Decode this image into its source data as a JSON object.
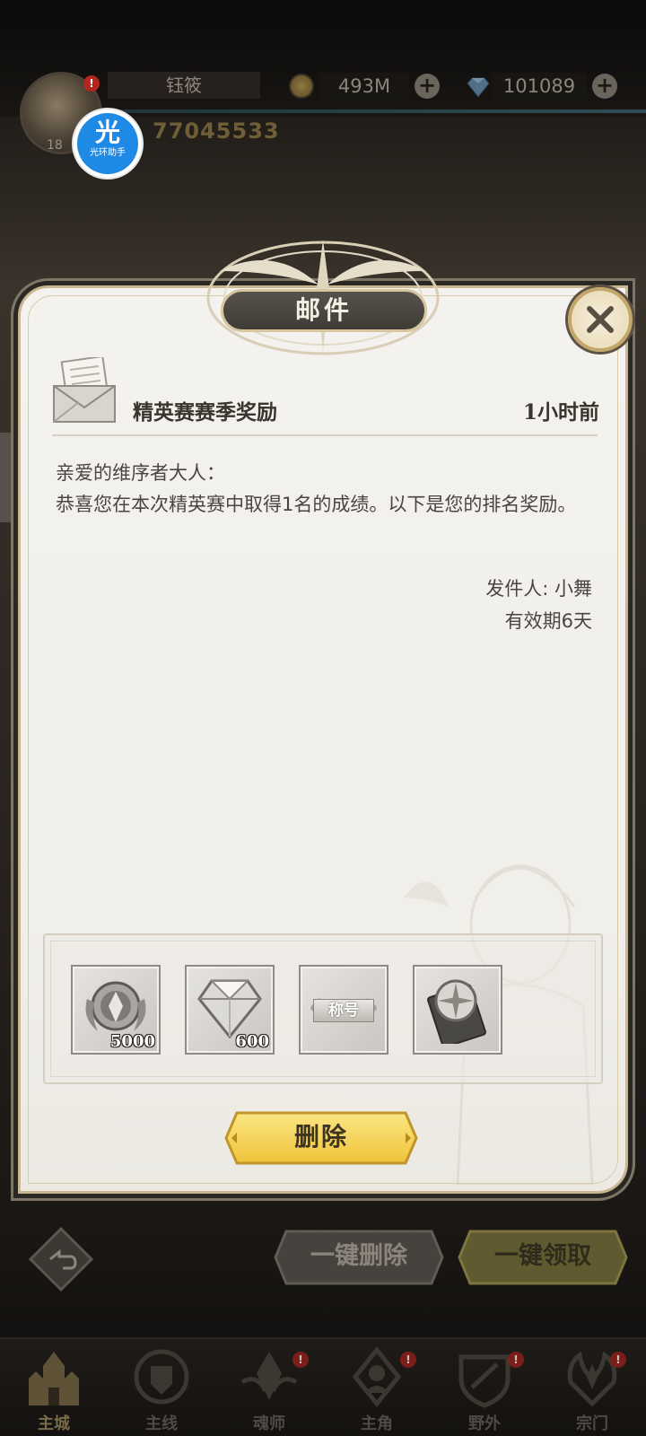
{
  "hud": {
    "player_name": "钰筱",
    "level": "18",
    "avatar_badge": "!",
    "gold": "493M",
    "diamonds": "101089",
    "plus": "+",
    "power": "77045533"
  },
  "helper": {
    "char": "光",
    "label": "光环助手"
  },
  "modal": {
    "title": "邮件",
    "mail": {
      "subject": "精英赛赛季奖励",
      "time": "1小时前",
      "body_line1": "亲爱的维序者大人：",
      "body_line2": "恭喜您在本次精英赛中取得1名的成绩。以下是您的排名奖励。",
      "sender": "发件人: 小舞",
      "validity": "有效期6天"
    },
    "rewards": [
      {
        "icon": "emblem-medal-icon",
        "count": "5000"
      },
      {
        "icon": "diamond-icon",
        "count": "600"
      },
      {
        "icon": "title-tag-icon",
        "label": "称号"
      },
      {
        "icon": "compass-card-icon"
      }
    ],
    "delete_label": "删除"
  },
  "actions": {
    "delete_all": "一键删除",
    "claim_all": "一键领取"
  },
  "nav": {
    "items": [
      {
        "label": "主城",
        "icon": "castle-icon",
        "badge": ""
      },
      {
        "label": "主线",
        "icon": "shield-crest-icon",
        "badge": ""
      },
      {
        "label": "魂师",
        "icon": "spirit-master-icon",
        "badge": "!"
      },
      {
        "label": "主角",
        "icon": "hero-icon",
        "badge": "!"
      },
      {
        "label": "野外",
        "icon": "wilderness-shield-icon",
        "badge": "!"
      },
      {
        "label": "宗门",
        "icon": "sect-emblem-icon",
        "badge": "!"
      }
    ]
  },
  "colors": {
    "panel": "#f2f0ec",
    "gold_button": "#f2cf48",
    "border_gold": "#c8b791",
    "badge_red": "#b3261e"
  }
}
